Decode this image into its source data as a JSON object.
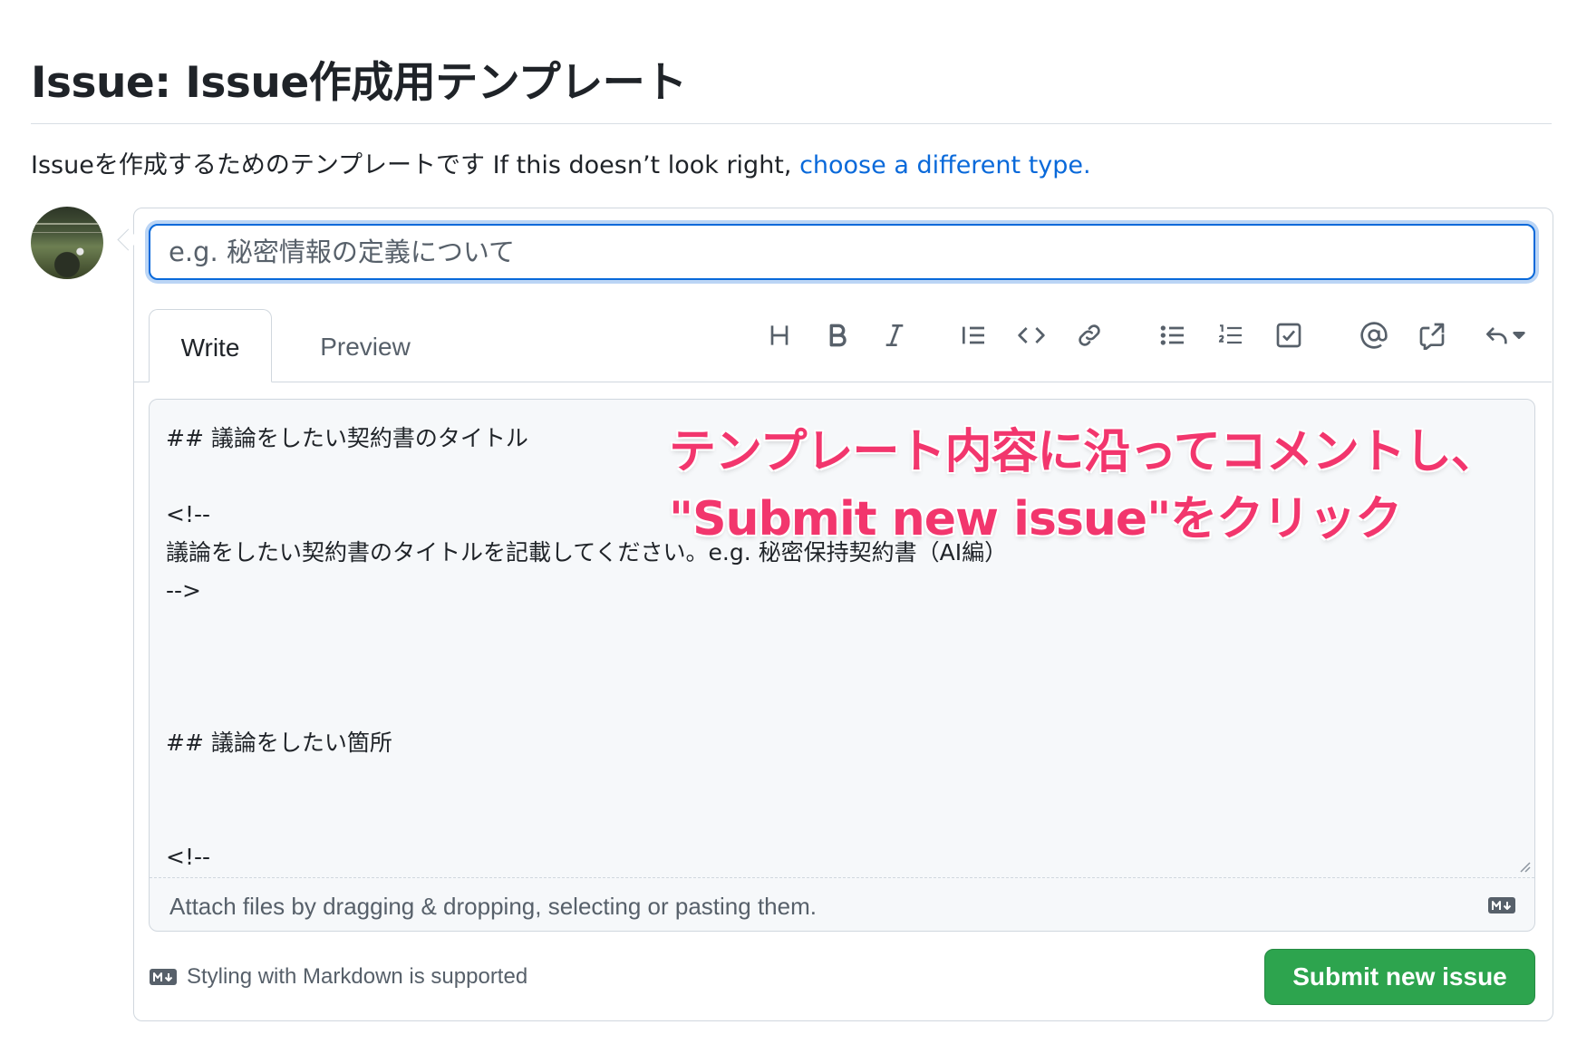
{
  "page": {
    "title": "Issue: Issue作成用テンプレート",
    "subtitle_text": "Issueを作成するためのテンプレートです If this doesn’t look right, ",
    "subtitle_link": "choose a different type."
  },
  "form": {
    "title_placeholder": "e.g. 秘密情報の定義について",
    "tabs": [
      {
        "label": "Write",
        "active": true
      },
      {
        "label": "Preview",
        "active": false
      }
    ],
    "toolbar_icons": [
      "heading-icon",
      "bold-icon",
      "italic-icon",
      "quote-icon",
      "code-icon",
      "link-icon",
      "bulleted-list-icon",
      "numbered-list-icon",
      "task-list-icon",
      "mention-icon",
      "cross-reference-icon",
      "saved-replies-icon"
    ],
    "body_text": "## 議論をしたい契約書のタイトル\n\n<!--\n議論をしたい契約書のタイトルを記載してください。e.g. 秘密保持契約書（AI編）\n-->\n\n\n\n## 議論をしたい箇所\n\n\n<!--\n議論をしたい具体的な場所を記載してください。\n列の冒頭に>を挿入し、該当箇所引用表記にすると見やすいです。",
    "attach_hint": "Attach files by dragging & dropping, selecting or pasting them.",
    "markdown_note": "Styling with Markdown is supported",
    "submit_label": "Submit new issue"
  },
  "annotation": {
    "line1": "テンプレート内容に沿ってコメントし、",
    "line2": "\"Submit new issue\"をクリック",
    "color": "#f2366d"
  },
  "colors": {
    "accent": "#0969da",
    "submit_green": "#2da44e"
  }
}
